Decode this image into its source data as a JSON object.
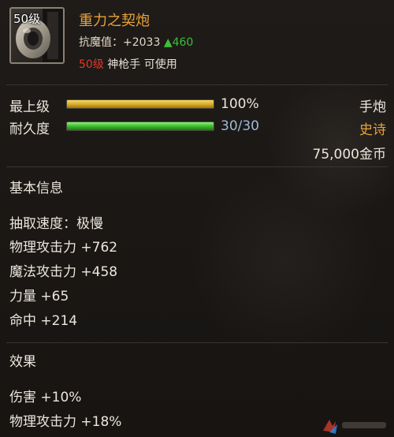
{
  "item": {
    "level_badge": "50级",
    "name": "重力之契炮",
    "magic_resist_label": "抗魔值：",
    "magic_resist_value": "+2033",
    "magic_resist_bonus": "▲460",
    "required_level": "50级",
    "class_usable": "神枪手 可使用"
  },
  "stats": {
    "grade_label": "最上级",
    "grade_value": "100%",
    "grade_fraction": 1.0,
    "durability_label": "耐久度",
    "durability_value": "30/30",
    "durability_fraction": 1.0,
    "weapon_type": "手炮",
    "rarity": "史诗",
    "price": "75,000金币"
  },
  "basic_info": {
    "title": "基本信息",
    "lines": [
      "抽取速度：极慢",
      "物理攻击力 +762",
      "魔法攻击力 +458",
      "力量 +65",
      "命中 +214"
    ]
  },
  "effects": {
    "title": "效果",
    "lines": [
      "伤害 +10%",
      "物理攻击力 +18%"
    ]
  },
  "colors": {
    "item_name": "#e8a23a",
    "rarity": "#e8a23a",
    "required_level": "#e03a2a",
    "bonus_green": "#3dbf3a",
    "durability_text": "#9fb8d8"
  }
}
